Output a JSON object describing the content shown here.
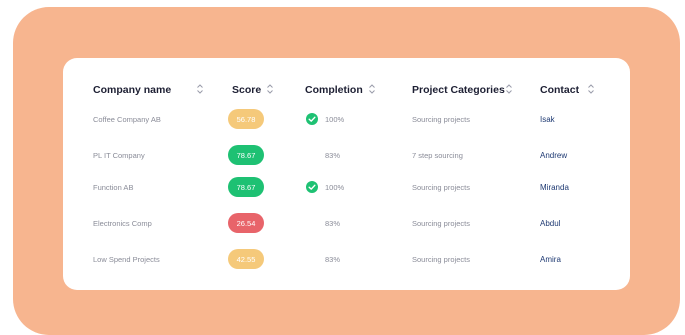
{
  "colors": {
    "frame_background": "#f7b58f",
    "score_high": "#1ec173",
    "score_mid": "#f5c97a",
    "score_low": "#e8646a",
    "check": "#1ec173",
    "contact_text": "#1f3a73"
  },
  "table": {
    "headers": {
      "company": "Company name",
      "score": "Score",
      "completion": "Completion",
      "categories": "Project Categories",
      "contact": "Contact"
    },
    "rows": [
      {
        "company": "Coffee Company AB",
        "score": "56.78",
        "score_level": "mid",
        "completed": true,
        "completion": "100%",
        "category": "Sourcing projects",
        "contact": "Isak"
      },
      {
        "company": "PL IT Company",
        "score": "78.67",
        "score_level": "high",
        "completed": false,
        "completion": "83%",
        "category": "7 step sourcing",
        "contact": "Andrew"
      },
      {
        "company": "Function AB",
        "score": "78.67",
        "score_level": "high",
        "completed": true,
        "completion": "100%",
        "category": "Sourcing projects",
        "contact": "Miranda"
      },
      {
        "company": "Electronics Comp",
        "score": "26.54",
        "score_level": "low",
        "completed": false,
        "completion": "83%",
        "category": "Sourcing projects",
        "contact": "Abdul"
      },
      {
        "company": "Low Spend Projects",
        "score": "42.55",
        "score_level": "mid",
        "completed": false,
        "completion": "83%",
        "category": "Sourcing projects",
        "contact": "Amira"
      }
    ]
  }
}
